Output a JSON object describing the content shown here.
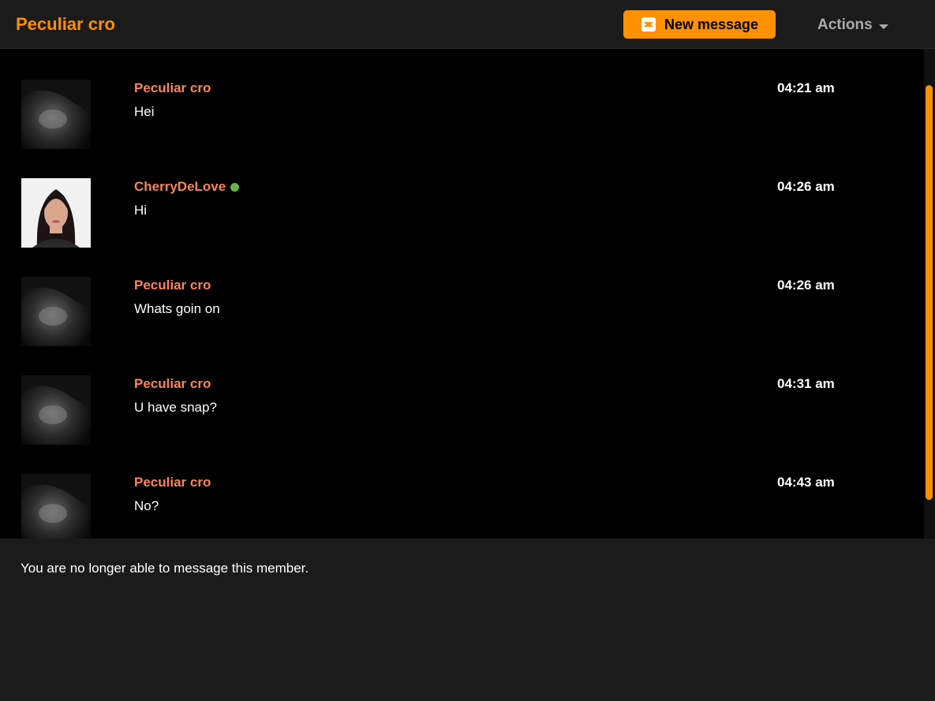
{
  "header": {
    "title": "Peculiar cro",
    "new_message_label": "New message",
    "actions_label": "Actions"
  },
  "messages": [
    {
      "sender": "Peculiar cro",
      "text": "Hei",
      "time": "04:21 am",
      "online": false
    },
    {
      "sender": "CherryDeLove",
      "text": "Hi",
      "time": "04:26 am",
      "online": true
    },
    {
      "sender": "Peculiar cro",
      "text": "Whats goin on",
      "time": "04:26 am",
      "online": false
    },
    {
      "sender": "Peculiar cro",
      "text": "U have snap?",
      "time": "04:31 am",
      "online": false
    },
    {
      "sender": "Peculiar cro",
      "text": "No?",
      "time": "04:43 am",
      "online": false
    }
  ],
  "footer": {
    "notice": "You are no longer able to message this member."
  },
  "colors": {
    "accent": "#ff9000",
    "sender_name": "#f7865b",
    "online": "#6ab04c"
  }
}
